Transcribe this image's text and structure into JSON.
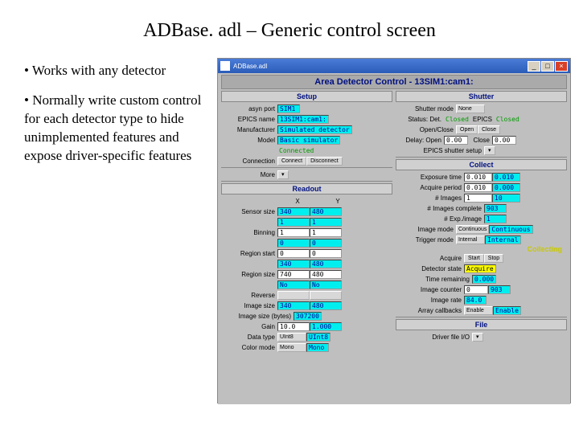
{
  "title": "ADBase. adl – Generic control screen",
  "bullets": {
    "b1": "• Works with any detector",
    "b2": "• Normally write custom control for each detector type to hide unimplemented features and expose driver-specific features"
  },
  "win": {
    "title": "ADBase.adl",
    "minimize": "_",
    "maximize": "□",
    "close": "×"
  },
  "app": {
    "title": "Area Detector Control - 13SIM1:cam1:",
    "setup": {
      "header": "Setup",
      "asyn_port_lbl": "asyn port",
      "asyn_port": "SIM1",
      "epics_name_lbl": "EPICS name",
      "epics_name": "13SIM1:cam1:",
      "manufacturer_lbl": "Manufacturer",
      "manufacturer": "Simulated detector",
      "model_lbl": "Model",
      "model": "Basic simulator",
      "connected": "Connected",
      "connection_lbl": "Connection",
      "connect_btn": "Connect",
      "disconnect_btn": "Disconnect",
      "more_lbl": "More",
      "more_btn": "▾"
    },
    "readout": {
      "header": "Readout",
      "x_hdr": "X",
      "y_hdr": "Y",
      "sensor_lbl": "Sensor size",
      "sensor_x": "340",
      "sensor_y": "480",
      "one_x": "1",
      "one_y": "1",
      "binning_lbl": "Binning",
      "bin_x": "1",
      "bin_y": "1",
      "zero_x": "0",
      "zero_y": "0",
      "region_start_lbl": "Region start",
      "rstart_x": "0",
      "rstart_y": "0",
      "size_x": "340",
      "size_y": "480",
      "region_size_lbl": "Region size",
      "rsize_x": "740",
      "rsize_y": "480",
      "yes_x": "No",
      "yes_y": "No",
      "reverse_lbl": "Reverse",
      "img_size_lbl": "Image size",
      "img_x": "340",
      "img_y": "480",
      "img_bytes_lbl": "Image size (bytes)",
      "img_bytes": "307200",
      "gain_lbl": "Gain",
      "gain_in": "10.0",
      "gain_val": "1.000",
      "data_type_lbl": "Data type",
      "data_type_sel": "UInt8",
      "data_type_val": "UInt8",
      "color_mode_lbl": "Color mode",
      "color_mode_sel": "Mono",
      "color_mode_val": "Mono"
    },
    "shutter": {
      "header": "Shutter",
      "mode_lbl": "Shutter mode",
      "mode_sel": "None",
      "status_lbl": "Status: Det.",
      "status_det": "Closed",
      "epics_lbl": "EPICS",
      "status_epics": "Closed",
      "openclose_lbl": "Open/Close",
      "open_btn": "Open",
      "close_btn": "Close",
      "delay_lbl": "Delay: Open",
      "delay_open": "0.00",
      "delay_close_lbl": "Close",
      "delay_close": "0.00",
      "epics_setup_lbl": "EPICS shutter setup",
      "epics_setup_btn": "▾"
    },
    "collect": {
      "header": "Collect",
      "exp_lbl": "Exposure time",
      "exp_in": "0.010",
      "exp_val": "0.010",
      "acq_lbl": "Acquire period",
      "acq_in": "0.010",
      "acq_val": "0.000",
      "num_lbl": "# Images",
      "num_in": "1",
      "num_val": "10",
      "complete_lbl": "# Images complete",
      "complete": "903",
      "expimg_lbl": "# Exp./image",
      "expimg": "1",
      "img_mode_lbl": "Image mode",
      "img_mode_sel": "Continuous",
      "img_mode_val": "Continuous",
      "trig_mode_lbl": "Trigger mode",
      "trig_mode_sel": "Internal",
      "trig_mode_val": "Internal",
      "collecting": "Collecting",
      "acquire_lbl": "Acquire",
      "start_btn": "Start",
      "stop_btn": "Stop",
      "det_state_lbl": "Detector state",
      "det_state": "Acquire",
      "time_rem_lbl": "Time remaining",
      "time_rem": "0.000",
      "img_counter_lbl": "Image counter",
      "img_counter_in": "0",
      "img_counter_val": "903",
      "img_rate_lbl": "Image rate",
      "img_rate": "84.0",
      "array_cb_lbl": "Array callbacks",
      "array_cb_sel": "Enable",
      "array_cb_val": "Enable"
    },
    "file": {
      "header": "File",
      "driver_lbl": "Driver file I/O",
      "driver_btn": "▾"
    }
  }
}
